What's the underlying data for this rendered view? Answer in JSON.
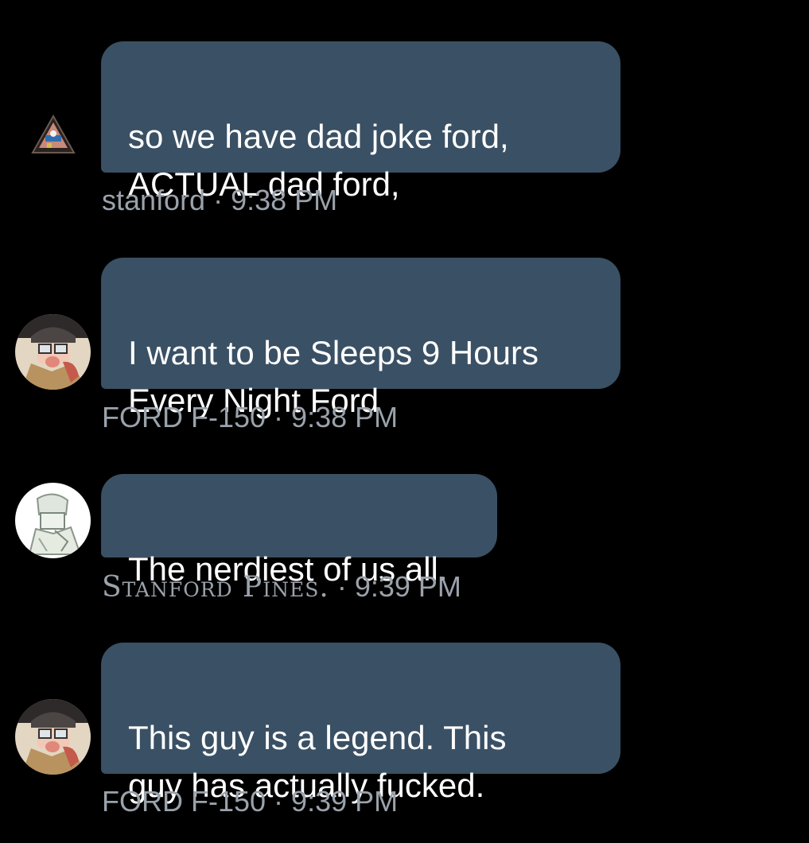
{
  "messages": [
    {
      "text": "so we have dad joke ford,\nACTUAL dad ford,",
      "author": "stanford",
      "separator": " · ",
      "time": "9:38 PM",
      "avatar": "illuminati-triangle-avatar"
    },
    {
      "text": "I want to be Sleeps 9 Hours\nEvery Night Ford",
      "author": "FORD F-150",
      "separator": " · ",
      "time": "9:38 PM",
      "avatar": "ford-cartoon-avatar"
    },
    {
      "text": "The nerdiest of us all.",
      "author": "Stanford Pines.",
      "separator": " · ",
      "time": "9:39 PM",
      "avatar": "ford-sketch-avatar"
    },
    {
      "text": "This guy is a legend. This\nguy has actually fucked.",
      "author": "FORD F-150",
      "separator": " · ",
      "time": "9:39 PM",
      "avatar": "ford-cartoon-avatar"
    }
  ],
  "colors": {
    "background": "#000000",
    "bubble": "#3a5064",
    "meta_text": "#9aa2ab"
  }
}
